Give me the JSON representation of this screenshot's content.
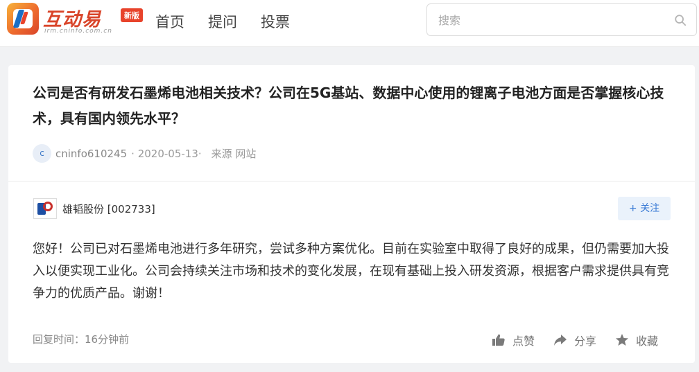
{
  "header": {
    "logo_text": "互动易",
    "logo_sub": "irm.cninfo.com.cn",
    "logo_badge": "新版",
    "nav": [
      "首页",
      "提问",
      "投票"
    ],
    "search_placeholder": "搜索"
  },
  "question": {
    "title": "公司是否有研发石墨烯电池相关技术？公司在5G基站、数据中心使用的锂离子电池方面是否掌握核心技术，具有国内领先水平？",
    "avatar_letter": "c",
    "user": "cninfo610245",
    "date": "· 2020-05-13·",
    "source": "来源 网站"
  },
  "reply": {
    "company": "雄韬股份 [002733]",
    "follow_label": "关注",
    "answer": "您好！公司已对石墨烯电池进行多年研究，尝试多种方案优化。目前在实验室中取得了良好的成果，但仍需要加大投入以便实现工业化。公司会持续关注市场和技术的变化发展，在现有基础上投入研发资源，根据客户需求提供具有竞争力的优质产品。谢谢！",
    "reply_time": "回复时间：16分钟前",
    "actions": {
      "like": "点赞",
      "share": "分享",
      "collect": "收藏"
    }
  },
  "colors": {
    "brand": "#d9452a",
    "accent": "#3a7bd5",
    "background": "#f1f2f4"
  }
}
